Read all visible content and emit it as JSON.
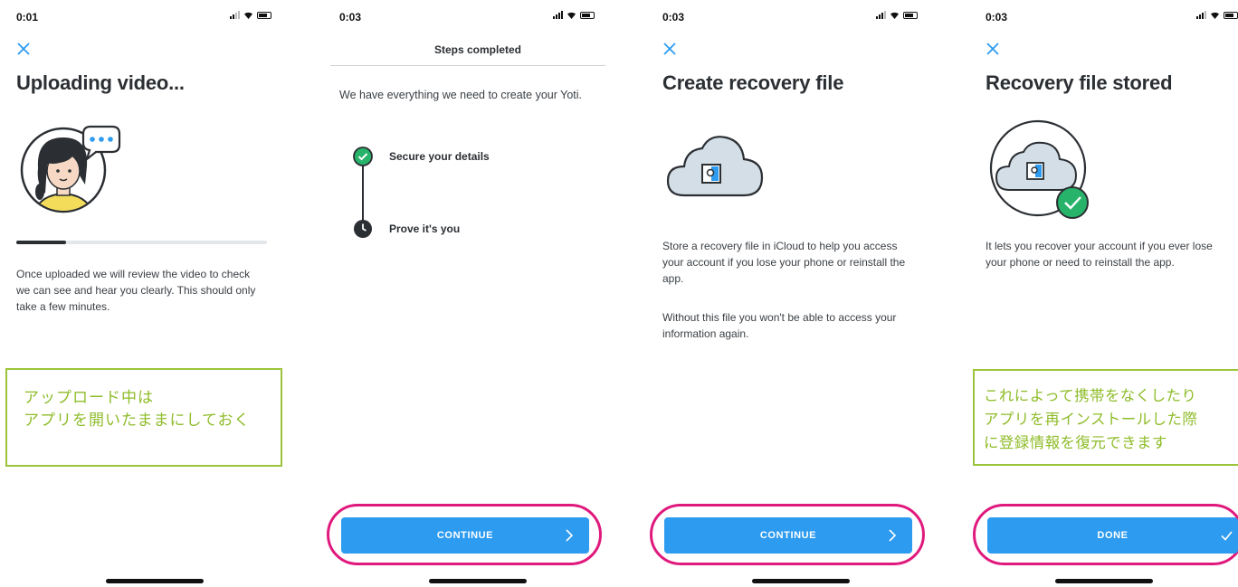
{
  "screens": [
    {
      "status_time": "0:01",
      "title": "Uploading video...",
      "upload_progress": 0.2,
      "body": "Once uploaded we will review the video to check we can see and hear you clearly. This should only take a few minutes.",
      "annotation": "アップロード中は\nアプリを開いたままにしておく"
    },
    {
      "status_time": "0:03",
      "header": "Steps completed",
      "body": "We have everything we need to create your Yoti.",
      "steps": [
        {
          "label": "Secure your details",
          "status": "complete"
        },
        {
          "label": "Prove it's you",
          "status": "pending"
        }
      ],
      "button": "CONTINUE"
    },
    {
      "status_time": "0:03",
      "title": "Create recovery file",
      "body": "Store a recovery file in iCloud to help you access your account if you lose your phone or reinstall the app.",
      "body2": "Without this file you won't be able to access your information again.",
      "button": "CONTINUE"
    },
    {
      "status_time": "0:03",
      "title": "Recovery file stored",
      "body": "It lets you recover your account if you ever lose your phone or need to reinstall the app.",
      "annotation": "これによって携帯をなくしたり\nアプリを再インストールした際\nに登録情報を復元できます",
      "button": "DONE"
    }
  ],
  "colors": {
    "button_blue": "#2d9bf0",
    "highlight_pink": "#e0197d",
    "annotation_green": "#9cc43b",
    "check_green": "#27b36a",
    "cloud_fill": "#d3dee6"
  },
  "icons": [
    "close-icon",
    "chevron-right-icon",
    "check-icon",
    "clock-icon",
    "cloud-icon",
    "avatar-illustration"
  ]
}
